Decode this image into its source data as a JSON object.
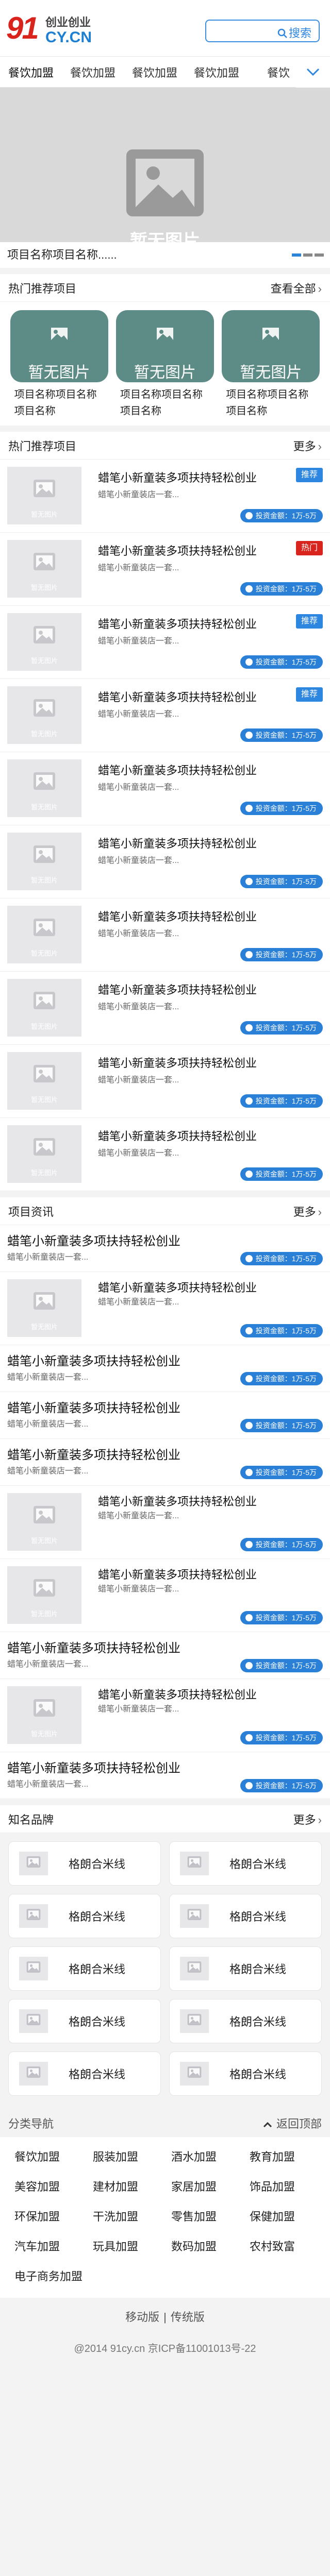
{
  "header": {
    "logo_number": "91",
    "logo_tagline": "创业创业",
    "logo_domain": "CY.CN",
    "search_label": "搜索"
  },
  "categories": [
    "餐饮加盟",
    "餐饮加盟",
    "餐饮加盟",
    "餐饮加盟",
    "餐饮"
  ],
  "banner": {
    "placeholder_text": "暂无图片",
    "caption": "项目名称项目名称......"
  },
  "hot": {
    "title": "热门推荐项目",
    "more": "查看全部",
    "more_arrow": "›",
    "cards": [
      {
        "pic_text": "暂无图片",
        "caption": "项目名称项目名称项目名称"
      },
      {
        "pic_text": "暂无图片",
        "caption": "项目名称项目名称项目名称"
      },
      {
        "pic_text": "暂无图片",
        "caption": "项目名称项目名称项目名称"
      }
    ]
  },
  "recommend": {
    "title": "热门推荐项目",
    "more": "更多",
    "more_arrow": "›",
    "items": [
      {
        "thumb": "暂无图片",
        "title": "蜡笔小新童装多项扶持轻松创业",
        "desc": "蜡笔小新童装店一套...",
        "badge": "推荐",
        "badge_color": "#2d86e0",
        "invest": "投资金额：1万-5万"
      },
      {
        "thumb": "暂无图片",
        "title": "蜡笔小新童装多项扶持轻松创业",
        "desc": "蜡笔小新童装店一套...",
        "badge": "热门",
        "badge_color": "#d8241c",
        "invest": "投资金额：1万-5万"
      },
      {
        "thumb": "暂无图片",
        "title": "蜡笔小新童装多项扶持轻松创业",
        "desc": "蜡笔小新童装店一套...",
        "badge": "推荐",
        "badge_color": "#2d86e0",
        "invest": "投资金额：1万-5万"
      },
      {
        "thumb": "暂无图片",
        "title": "蜡笔小新童装多项扶持轻松创业",
        "desc": "蜡笔小新童装店一套...",
        "badge": "推荐",
        "badge_color": "#2d86e0",
        "invest": "投资金额：1万-5万"
      },
      {
        "thumb": "暂无图片",
        "title": "蜡笔小新童装多项扶持轻松创业",
        "desc": "蜡笔小新童装店一套...",
        "badge": "",
        "badge_color": "",
        "invest": "投资金额：1万-5万"
      },
      {
        "thumb": "暂无图片",
        "title": "蜡笔小新童装多项扶持轻松创业",
        "desc": "蜡笔小新童装店一套...",
        "badge": "",
        "badge_color": "",
        "invest": "投资金额：1万-5万"
      },
      {
        "thumb": "暂无图片",
        "title": "蜡笔小新童装多项扶持轻松创业",
        "desc": "蜡笔小新童装店一套...",
        "badge": "",
        "badge_color": "",
        "invest": "投资金额：1万-5万"
      },
      {
        "thumb": "暂无图片",
        "title": "蜡笔小新童装多项扶持轻松创业",
        "desc": "蜡笔小新童装店一套...",
        "badge": "",
        "badge_color": "",
        "invest": "投资金额：1万-5万"
      },
      {
        "thumb": "暂无图片",
        "title": "蜡笔小新童装多项扶持轻松创业",
        "desc": "蜡笔小新童装店一套...",
        "badge": "",
        "badge_color": "",
        "invest": "投资金额：1万-5万"
      },
      {
        "thumb": "暂无图片",
        "title": "蜡笔小新童装多项扶持轻松创业",
        "desc": "蜡笔小新童装店一套...",
        "badge": "",
        "badge_color": "",
        "invest": "投资金额：1万-5万"
      }
    ]
  },
  "news": {
    "title": "项目资讯",
    "more": "更多",
    "more_arrow": "›",
    "items": [
      {
        "type": "text",
        "title": "蜡笔小新童装多项扶持轻松创业",
        "desc": "蜡笔小新童装店一套...",
        "invest": "投资金额：1万-5万"
      },
      {
        "type": "img",
        "thumb": "暂无图片",
        "title": "蜡笔小新童装多项扶持轻松创业",
        "desc": "蜡笔小新童装店一套...",
        "invest": "投资金额：1万-5万"
      },
      {
        "type": "text",
        "title": "蜡笔小新童装多项扶持轻松创业",
        "desc": "蜡笔小新童装店一套...",
        "invest": "投资金额：1万-5万"
      },
      {
        "type": "text",
        "title": "蜡笔小新童装多项扶持轻松创业",
        "desc": "蜡笔小新童装店一套...",
        "invest": "投资金额：1万-5万"
      },
      {
        "type": "text",
        "title": "蜡笔小新童装多项扶持轻松创业",
        "desc": "蜡笔小新童装店一套...",
        "invest": "投资金额：1万-5万"
      },
      {
        "type": "img",
        "thumb": "暂无图片",
        "title": "蜡笔小新童装多项扶持轻松创业",
        "desc": "蜡笔小新童装店一套...",
        "invest": "投资金额：1万-5万"
      },
      {
        "type": "img",
        "thumb": "暂无图片",
        "title": "蜡笔小新童装多项扶持轻松创业",
        "desc": "蜡笔小新童装店一套...",
        "invest": "投资金额：1万-5万"
      },
      {
        "type": "text",
        "title": "蜡笔小新童装多项扶持轻松创业",
        "desc": "蜡笔小新童装店一套...",
        "invest": "投资金额：1万-5万"
      },
      {
        "type": "img",
        "thumb": "暂无图片",
        "title": "蜡笔小新童装多项扶持轻松创业",
        "desc": "蜡笔小新童装店一套...",
        "invest": "投资金额：1万-5万"
      },
      {
        "type": "text",
        "title": "蜡笔小新童装多项扶持轻松创业",
        "desc": "蜡笔小新童装店一套...",
        "invest": "投资金额：1万-5万"
      }
    ]
  },
  "brands": {
    "title": "知名品牌",
    "more": "更多",
    "more_arrow": "›",
    "items": [
      "格朗合米线",
      "格朗合米线",
      "格朗合米线",
      "格朗合米线",
      "格朗合米线",
      "格朗合米线",
      "格朗合米线",
      "格朗合米线",
      "格朗合米线",
      "格朗合米线"
    ]
  },
  "nav": {
    "title": "分类导航",
    "back_top": "返回顶部",
    "items": [
      "餐饮加盟",
      "服装加盟",
      "酒水加盟",
      "教育加盟",
      "美容加盟",
      "建材加盟",
      "家居加盟",
      "饰品加盟",
      "环保加盟",
      "干洗加盟",
      "零售加盟",
      "保健加盟",
      "汽车加盟",
      "玩具加盟",
      "数码加盟",
      "农村致富",
      "电子商务加盟"
    ]
  },
  "footer": {
    "mobile": "移动版",
    "sep": "|",
    "classic": "传统版",
    "copyright": "@2014 91cy.cn 京ICP备11001013号-22"
  },
  "colors": {
    "brand_red": "#d8241c",
    "brand_blue": "#2d86e0",
    "hot_card": "#5d8b86"
  }
}
